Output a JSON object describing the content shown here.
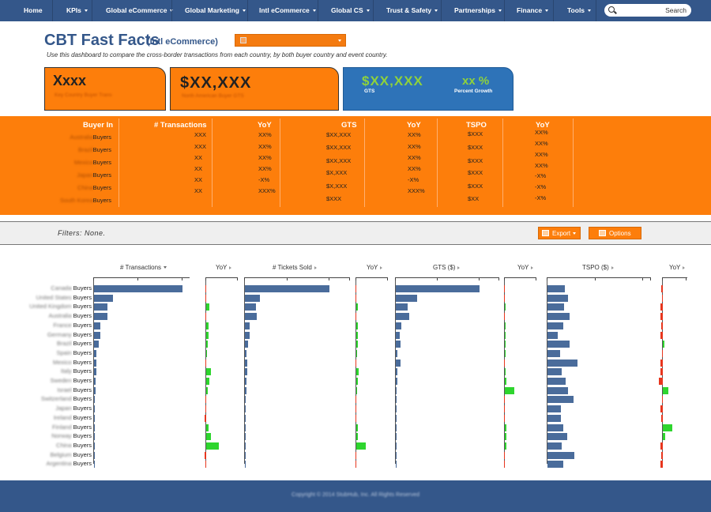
{
  "nav": {
    "items": [
      {
        "label": "Home",
        "dropdown": false
      },
      {
        "label": "KPIs",
        "dropdown": true
      },
      {
        "label": "Global eCommerce",
        "dropdown": true
      },
      {
        "label": "Global Marketing",
        "dropdown": true
      },
      {
        "label": "Intl eCommerce",
        "dropdown": true
      },
      {
        "label": "Global CS",
        "dropdown": true
      },
      {
        "label": "Trust & Safety",
        "dropdown": true
      },
      {
        "label": "Partnerships",
        "dropdown": true
      },
      {
        "label": "Finance",
        "dropdown": true
      },
      {
        "label": "Tools",
        "dropdown": true
      }
    ],
    "search_placeholder": "",
    "search_button": "Search"
  },
  "header": {
    "title": "CBT Fast Facts",
    "subtitle": "(Intl eCommerce)",
    "description": "Use this dashboard to compare the cross-border transactions from each country, by both buyer country and event country."
  },
  "kpis": {
    "card1": {
      "value": "Xxxx",
      "label": "Key Country Buyer Trans"
    },
    "card2": {
      "value": "$XX,XXX",
      "label": "North American Buyer GTS"
    },
    "card3": {
      "value": "$XX,XXX",
      "label": "GTS",
      "growth_value": "xx %",
      "growth_label": "Percent Growth"
    }
  },
  "summary": {
    "headers": [
      "Buyer In",
      "# Transactions",
      "YoY",
      "GTS",
      "YoY",
      "TSPO",
      "YoY"
    ],
    "buyers_suffix": "Buyers",
    "rows": [
      {
        "country": "Australia",
        "trans": "XXX",
        "yoy1": "XX%",
        "gts": "$XX,XXX",
        "yoy2": "XX%",
        "tspo": "$XXX",
        "yoy3": "XX%"
      },
      {
        "country": "Brazil",
        "trans": "XXX",
        "yoy1": "XX%",
        "gts": "$XX,XXX",
        "yoy2": "XX%",
        "tspo": "$XXX",
        "yoy3": "XX%"
      },
      {
        "country": "Mexico",
        "trans": "XX",
        "yoy1": "XX%",
        "gts": "$XX,XXX",
        "yoy2": "XX%",
        "tspo": "$XXX",
        "yoy3": "XX%"
      },
      {
        "country": "Japan",
        "trans": "XX",
        "yoy1": "XX%",
        "gts": "$X,XXX",
        "yoy2": "XX%",
        "tspo": "$XXX",
        "yoy3": "XX%"
      },
      {
        "country": "China",
        "trans": "XX",
        "yoy1": "-X%",
        "gts": "$X,XXX",
        "yoy2": "-X%",
        "tspo": "$XXX",
        "yoy3": "-X%"
      },
      {
        "country": "South Korea",
        "trans": "XX",
        "yoy1": "XXX%",
        "gts": "$X,XXX",
        "yoy2": "XXX%",
        "tspo": "$XXX",
        "yoy3": "-X%"
      },
      {
        "country": "",
        "trans": "XX",
        "yoy1": "XX%",
        "gts": "$XXX",
        "yoy2": "XX%",
        "tspo": "$XX",
        "yoy3": "-X%"
      }
    ]
  },
  "filters": {
    "text": "Filters: None.",
    "export_label": "Export",
    "options_label": "Options"
  },
  "chart_data": {
    "type": "bar",
    "columns": [
      "# Transactions",
      "YoY",
      "# Tickets Sold",
      "YoY",
      "GTS ($)",
      "YoY",
      "TSPO ($)",
      "YoY"
    ],
    "buyers_suffix": "Buyers",
    "categories": [
      "Canada",
      "United States",
      "United Kingdom",
      "Australia",
      "France",
      "Germany",
      "Brazil",
      "Spain",
      "Mexico",
      "Italy",
      "Sweden",
      "Israel",
      "Switzerland",
      "Japan",
      "Ireland",
      "Finland",
      "Norway",
      "China",
      "Belgium",
      "Argentina"
    ],
    "series": [
      {
        "values": [
          100,
          21,
          15,
          15,
          7,
          7,
          5,
          3,
          3,
          3,
          2,
          2,
          1,
          1,
          1,
          1,
          1,
          1,
          1,
          1
        ]
      },
      {
        "values": [
          0,
          0,
          4,
          0,
          3,
          3,
          2,
          1,
          0,
          6,
          4,
          2,
          0,
          0,
          2,
          3,
          6,
          16,
          2,
          0
        ]
      },
      {
        "values": [
          100,
          18,
          13,
          14,
          6,
          6,
          4,
          2,
          3,
          3,
          2,
          2,
          1,
          1,
          1,
          1,
          1,
          1,
          1,
          1
        ]
      },
      {
        "values": [
          1,
          0,
          2,
          0,
          2,
          2,
          2,
          1,
          0,
          3,
          2,
          1,
          0,
          0,
          1,
          2,
          2,
          11,
          1,
          0
        ]
      },
      {
        "values": [
          100,
          25,
          14,
          16,
          7,
          5,
          6,
          2,
          6,
          2,
          2,
          1,
          1,
          1,
          1,
          1,
          1,
          1,
          1,
          1
        ]
      },
      {
        "values": [
          1,
          0,
          1,
          0,
          1,
          1,
          1,
          0,
          0,
          1,
          2,
          10,
          0,
          0,
          1,
          2,
          2,
          2,
          1,
          1
        ]
      },
      {
        "values": [
          20,
          24,
          19,
          26,
          18,
          12,
          26,
          15,
          35,
          17,
          21,
          24,
          30,
          16,
          16,
          18,
          23,
          17,
          31,
          18
        ]
      },
      {
        "values": [
          1,
          0,
          2,
          2,
          1,
          2,
          1,
          0,
          2,
          2,
          3,
          4,
          0,
          2,
          1,
          7,
          2,
          2,
          1,
          2
        ]
      }
    ]
  },
  "footer": {
    "copyright": "Copyright © 2014 StubHub, Inc. All Rights Reserved"
  },
  "colors": {
    "nav": "#34578a",
    "orange": "#fd7e0b",
    "blue_card": "#2e73b8",
    "bar": "#4a6c9b",
    "positive": "#2ed52e",
    "negative": "#e8361e"
  }
}
